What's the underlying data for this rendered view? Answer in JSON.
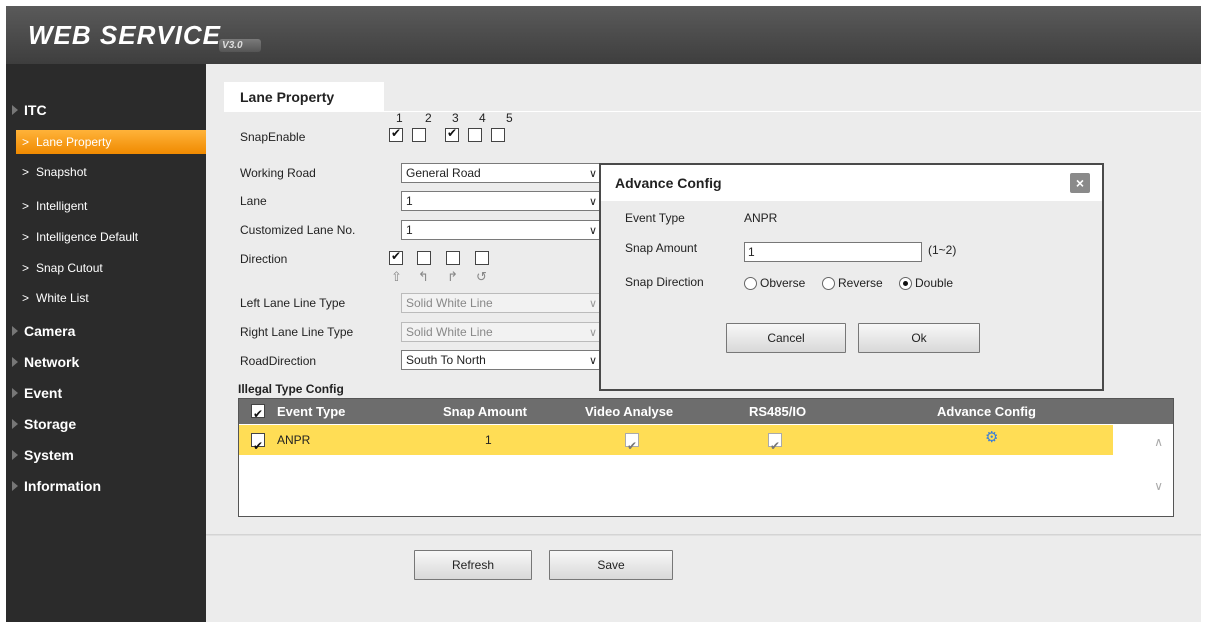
{
  "header": {
    "logo_text": "WEB  SERVICE",
    "logo_version": "V3.0"
  },
  "sidebar": {
    "groups": [
      {
        "label": "ITC"
      },
      {
        "label": "Camera"
      },
      {
        "label": "Network"
      },
      {
        "label": "Event"
      },
      {
        "label": "Storage"
      },
      {
        "label": "System"
      },
      {
        "label": "Information"
      }
    ],
    "itc_items": [
      {
        "label": "Lane Property",
        "active": true
      },
      {
        "label": "Snapshot"
      },
      {
        "label": "Intelligent"
      },
      {
        "label": "Intelligence Default"
      },
      {
        "label": "Snap Cutout"
      },
      {
        "label": "White List"
      }
    ],
    "chevron": ">"
  },
  "page": {
    "tab": "Lane Property",
    "snap_enable": {
      "label": "SnapEnable",
      "numbers": [
        "1",
        "2",
        "3",
        "4",
        "5"
      ],
      "checked": [
        true,
        false,
        true,
        false,
        false
      ]
    },
    "working_road": {
      "label": "Working Road",
      "value": "General Road"
    },
    "lane": {
      "label": "Lane",
      "value": "1"
    },
    "customized_lane": {
      "label": "Customized Lane No.",
      "value": "1"
    },
    "direction": {
      "label": "Direction",
      "checked": [
        true,
        false,
        false,
        false
      ],
      "icons": [
        "straight-arrow-icon",
        "left-turn-icon",
        "right-turn-icon",
        "u-turn-icon"
      ]
    },
    "left_lane_line": {
      "label": "Left Lane Line Type",
      "value": "Solid White Line"
    },
    "right_lane_line": {
      "label": "Right Lane Line Type",
      "value": "Solid White Line"
    },
    "road_direction": {
      "label": "RoadDirection",
      "value": "South To North"
    },
    "illegal_title": "Illegal Type Config",
    "table": {
      "headers": [
        "Event Type",
        "Snap Amount",
        "Video Analyse",
        "RS485/IO",
        "Advance Config"
      ],
      "rows": [
        {
          "event_type": "ANPR",
          "snap_amount": "1",
          "video_analyse": true,
          "rs485": true,
          "advance_icon": "gear-icon"
        }
      ]
    },
    "buttons": {
      "refresh": "Refresh",
      "save": "Save"
    }
  },
  "dialog": {
    "title": "Advance Config",
    "close": "×",
    "event_type_label": "Event Type",
    "event_type_value": "ANPR",
    "snap_amount_label": "Snap Amount",
    "snap_amount_value": "1",
    "snap_amount_range": "(1~2)",
    "snap_direction_label": "Snap Direction",
    "options": [
      "Obverse",
      "Reverse",
      "Double"
    ],
    "selected": "Double",
    "cancel": "Cancel",
    "ok": "Ok"
  },
  "colors": {
    "active_nav": "#f39a14",
    "row_highlight": "#ffdd55",
    "sidebar": "#2b2b2b",
    "table_header": "#6d6d6d"
  }
}
